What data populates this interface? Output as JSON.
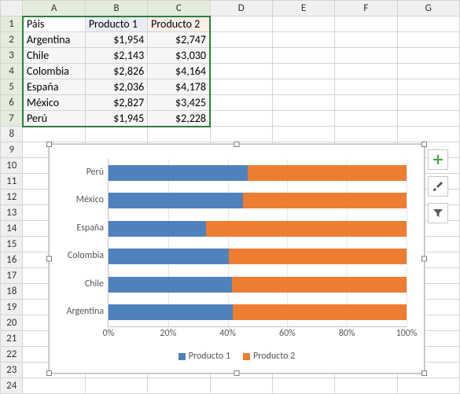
{
  "columns": [
    "A",
    "B",
    "C",
    "D",
    "E",
    "F",
    "G"
  ],
  "rowcount": 24,
  "headers": {
    "A": "Páis",
    "B": "Producto 1",
    "C": "Producto 2"
  },
  "rows": [
    {
      "pais": "Argentina",
      "p1": "$1,954",
      "p2": "$2,747"
    },
    {
      "pais": "Chile",
      "p1": "$2,143",
      "p2": "$3,030"
    },
    {
      "pais": "Colombia",
      "p1": "$2,826",
      "p2": "$4,164"
    },
    {
      "pais": "España",
      "p1": "$2,036",
      "p2": "$4,178"
    },
    {
      "pais": "México",
      "p1": "$2,827",
      "p2": "$3,425"
    },
    {
      "pais": "Perú",
      "p1": "$1,945",
      "p2": "$2,228"
    }
  ],
  "chart_data": {
    "type": "bar",
    "orientation": "horizontal",
    "stacking": "percent",
    "categories": [
      "Perú",
      "México",
      "España",
      "Colombia",
      "Chile",
      "Argentina"
    ],
    "series": [
      {
        "name": "Producto 1",
        "color": "#4f81bd",
        "values": [
          1945,
          2827,
          2036,
          2826,
          2143,
          1954
        ]
      },
      {
        "name": "Producto 2",
        "color": "#ed7d31",
        "values": [
          2228,
          3425,
          4178,
          4164,
          3030,
          2747
        ]
      }
    ],
    "x_ticks": [
      "0%",
      "20%",
      "40%",
      "60%",
      "80%",
      "100%"
    ],
    "xlim": [
      0,
      100
    ]
  }
}
